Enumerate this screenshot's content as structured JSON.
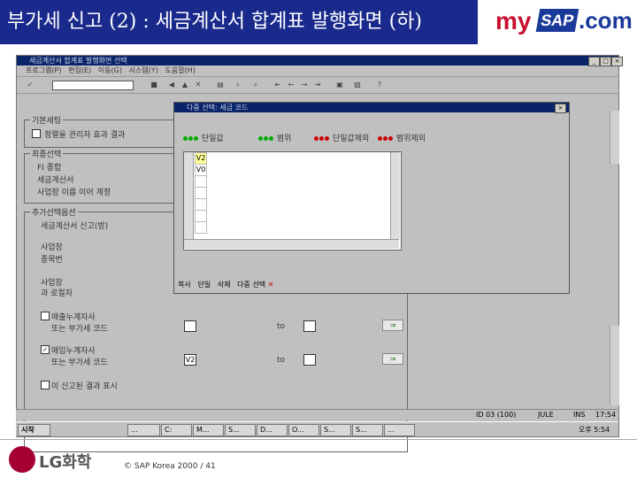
{
  "slide": {
    "title": "부가세 신고 (2) : 세금계산서 합계표 발행화면 (하)",
    "logo_my": "my",
    "logo_sap": "SAP",
    "logo_com": ".com",
    "company": "LG화학",
    "copyright": "© SAP Korea 2000 / 41"
  },
  "window": {
    "title": "세금계산서 합계표 발행화면 선택",
    "menu": [
      "프로그램(P)",
      "편집(E)",
      "이동(G)",
      "시스템(Y)",
      "도움말(H)"
    ],
    "groups": {
      "basic": {
        "title": "기본세팅",
        "items": [
          "정렬을 관리자 효과 결과"
        ]
      },
      "output": {
        "title": "최종선택",
        "items": [
          "FI 종합",
          "세금계산서",
          "사업장 이름 이어 계정"
        ]
      },
      "additional": {
        "title": "추가선택옵션",
        "items": [
          "세금계산서 신고(방)",
          "사업장",
          "종목번",
          "사업장",
          "과 로컬자"
        ]
      }
    },
    "checks": [
      {
        "label": "매출누계자사",
        "sub": "또는 부가세 코드",
        "checked": false,
        "to": "to"
      },
      {
        "label": "매입누계자사",
        "sub": "또는 부가세 코드",
        "checked": true,
        "value": "V2",
        "to": "to"
      },
      {
        "label": "이 신고된 결과 표시",
        "checked": false
      }
    ]
  },
  "popup": {
    "title": "다중 선택: 세금 코드",
    "tabs": [
      "단일값",
      "범위",
      "단일값제외",
      "범위제외"
    ],
    "grid_values": [
      "V2",
      "V0"
    ],
    "toolbar": [
      "복사",
      "단일",
      "삭제",
      "다중 선택"
    ]
  },
  "status": {
    "server": "ID 03 (100)",
    "user": "JULE",
    "mode": "INS",
    "time": "17:54"
  },
  "taskbar": {
    "start": "시작",
    "tasks": [
      "...",
      "C:",
      "M...",
      "S...",
      "D...",
      "O...",
      "S...",
      "S...",
      "..."
    ],
    "time": "오후 5:54"
  },
  "colors": {
    "title_bg": "#1a2a8c",
    "sap_blue": "#1a3a9a",
    "my_red": "#c8102e",
    "lg_red": "#a50034"
  }
}
